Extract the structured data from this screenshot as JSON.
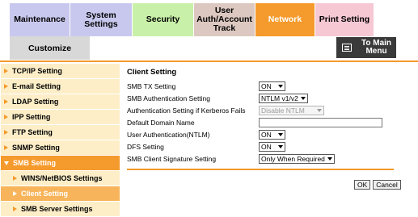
{
  "tabs": {
    "maintenance": "Maintenance",
    "system_settings": "System Settings",
    "security": "Security",
    "user_auth": "User Auth/Account Track",
    "network": "Network",
    "print_setting": "Print Setting",
    "customize": "Customize"
  },
  "main_menu": {
    "label": "To Main Menu",
    "icon": "menu-icon"
  },
  "sidebar": {
    "items": [
      {
        "label": "TCP/IP Setting"
      },
      {
        "label": "E-mail Setting"
      },
      {
        "label": "LDAP Setting"
      },
      {
        "label": "IPP Setting"
      },
      {
        "label": "FTP Setting"
      },
      {
        "label": "SNMP Setting"
      },
      {
        "label": "SMB Setting"
      }
    ],
    "subitems": [
      {
        "label": "WINS/NetBIOS Settings"
      },
      {
        "label": "Client Setting"
      },
      {
        "label": "SMB Server Settings"
      }
    ]
  },
  "content": {
    "title": "Client Setting",
    "fields": {
      "smb_tx": {
        "label": "SMB TX Setting",
        "value": "ON"
      },
      "smb_auth": {
        "label": "SMB Authentication Setting",
        "value": "NTLM v1/v2"
      },
      "kerberos_fail": {
        "label": "Authentication Setting if Kerberos Fails",
        "value": "Disable NTLM"
      },
      "default_domain": {
        "label": "Default Domain Name",
        "value": ""
      },
      "user_auth": {
        "label": "User Authentication(NTLM)",
        "value": "ON"
      },
      "dfs": {
        "label": "DFS Setting",
        "value": "ON"
      },
      "signature": {
        "label": "SMB Client Signature Setting",
        "value": "Only When Required"
      }
    },
    "ok_label": "OK",
    "cancel_label": "Cancel"
  },
  "colors": {
    "accent": "#f59a2c",
    "sidebar_bg": "#fdeec8",
    "tab_purple": "#c8c8ee",
    "tab_green": "#c8f0a8",
    "tab_brown": "#dcc8c0",
    "tab_pink": "#f6c8d4"
  }
}
